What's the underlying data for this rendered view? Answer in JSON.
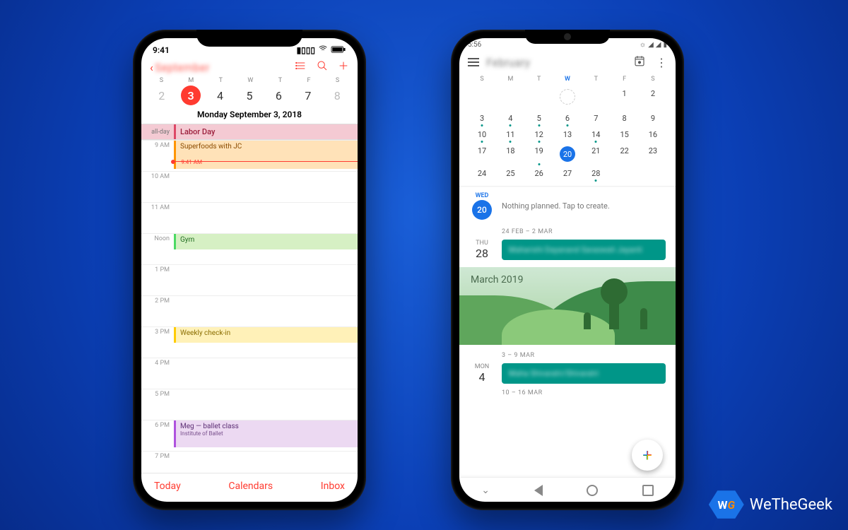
{
  "brand": {
    "logo_text": "WG",
    "name": "WeTheGeek"
  },
  "iphone": {
    "status": {
      "time": "9:41",
      "signal": "▮▮▮▮",
      "wifi": "wifi",
      "battery": "batt"
    },
    "back_label": "September",
    "week_headers": [
      "S",
      "M",
      "T",
      "W",
      "T",
      "F",
      "S"
    ],
    "week_days": [
      "2",
      "3",
      "4",
      "5",
      "6",
      "7",
      "8"
    ],
    "selected_day_index": 1,
    "date_line": "Monday  September 3, 2018",
    "allday": {
      "label": "all-day",
      "title": "Labor Day"
    },
    "now_label": "9:41 AM",
    "hours": [
      "9 AM",
      "10 AM",
      "11 AM",
      "Noon",
      "1 PM",
      "2 PM",
      "3 PM",
      "4 PM",
      "5 PM",
      "6 PM",
      "7 PM"
    ],
    "events": {
      "superfoods": "Superfoods with JC",
      "gym": "Gym",
      "weekly": "Weekly check-in",
      "ballet": "Meg — ballet class",
      "ballet_sub": "Institute of Ballet"
    },
    "bottom": {
      "today": "Today",
      "calendars": "Calendars",
      "inbox": "Inbox"
    }
  },
  "android": {
    "status_time": "5:56",
    "month_label": "February",
    "week_headers": [
      "S",
      "M",
      "T",
      "W",
      "T",
      "F",
      "S"
    ],
    "grid": [
      [
        "",
        "",
        "",
        "",
        "",
        "1",
        "2"
      ],
      [
        "3",
        "4",
        "5",
        "6",
        "7",
        "8",
        "9"
      ],
      [
        "10",
        "11",
        "12",
        "13",
        "14",
        "15",
        "16"
      ],
      [
        "17",
        "18",
        "19",
        "20",
        "21",
        "22",
        "23"
      ],
      [
        "24",
        "25",
        "26",
        "27",
        "28",
        "",
        ""
      ]
    ],
    "dots": [
      "3",
      "4",
      "5",
      "6",
      "10",
      "11",
      "12",
      "14",
      "19",
      "28"
    ],
    "today_circle": {
      "dw": "WED",
      "dn": "20",
      "msg": "Nothing planned. Tap to create."
    },
    "range1": "24 FEB – 2 MAR",
    "thu": {
      "dw": "THU",
      "dn": "28",
      "pill": "Maharishi Dayanand Saraswati Jayanti"
    },
    "march_label": "March 2019",
    "range2": "3 – 9 MAR",
    "mon": {
      "dw": "MON",
      "dn": "4",
      "pill": "Maha Shivaratri/Shivaratri"
    },
    "range3": "10 – 16 MAR"
  }
}
